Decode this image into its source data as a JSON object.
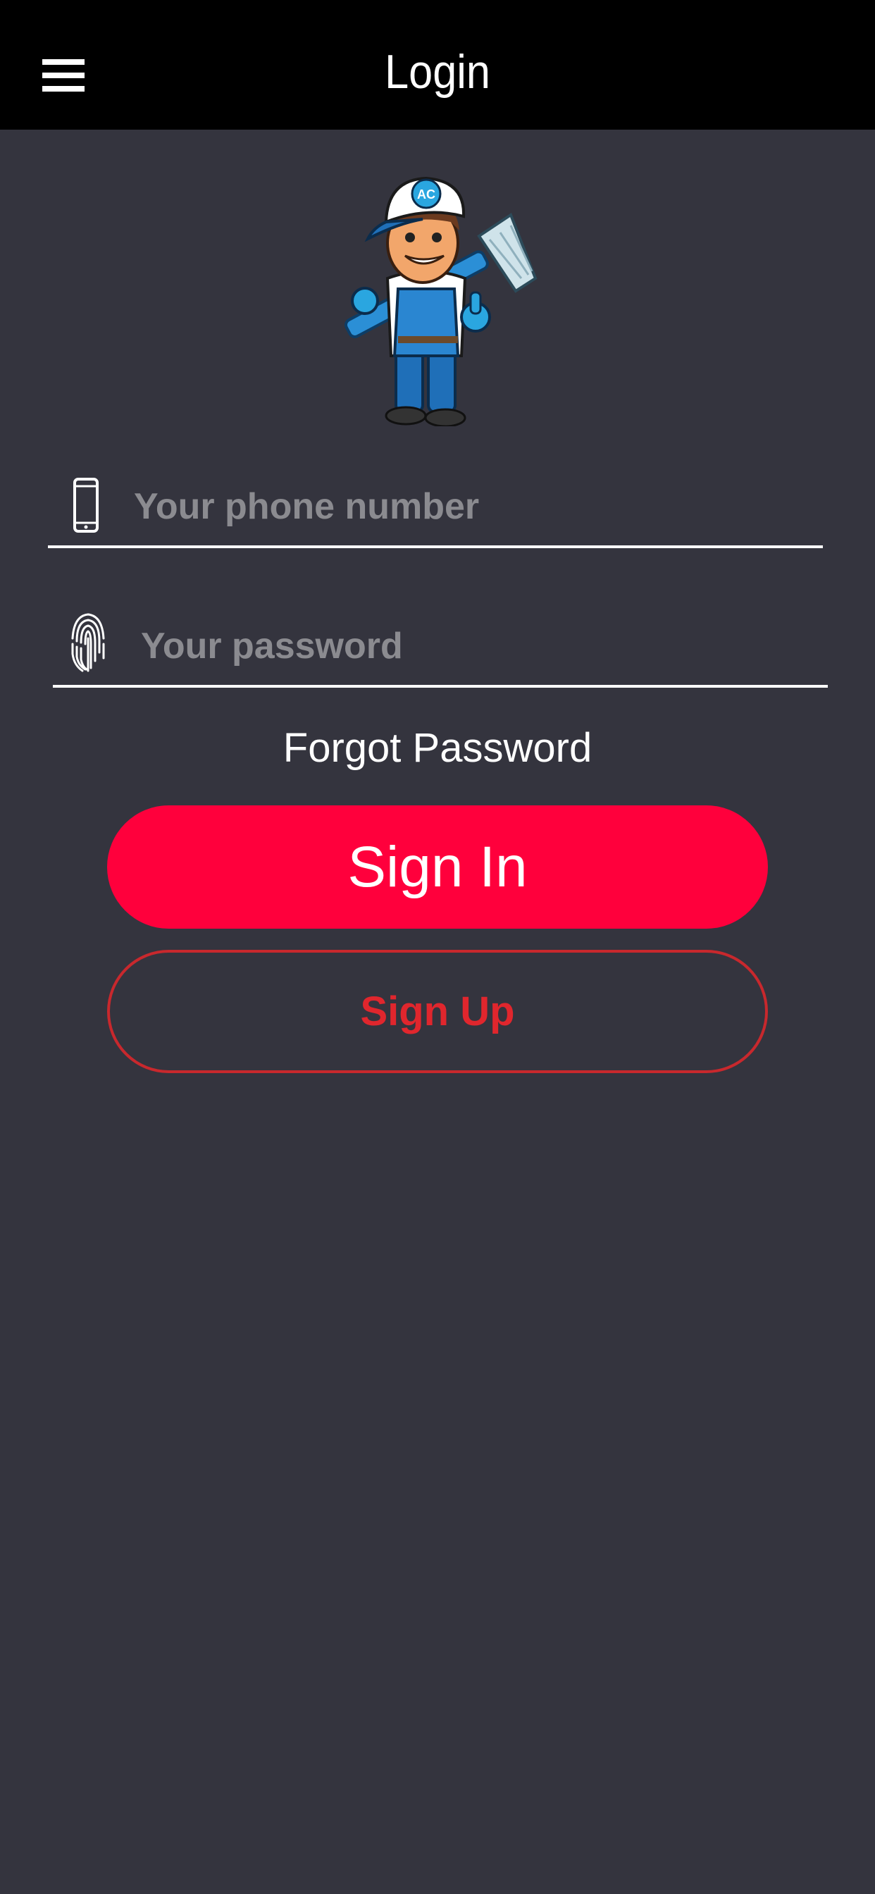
{
  "header": {
    "title": "Login",
    "menu_icon": "hamburger-menu-icon"
  },
  "logo": {
    "icon": "cleaner-mascot-logo",
    "cap_text": "AC"
  },
  "form": {
    "phone": {
      "placeholder": "Your phone number",
      "value": "",
      "icon": "smartphone-icon"
    },
    "password": {
      "placeholder": "Your password",
      "value": "",
      "icon": "fingerprint-icon"
    },
    "forgot_label": "Forgot Password"
  },
  "actions": {
    "signin_label": "Sign In",
    "signup_label": "Sign Up"
  },
  "colors": {
    "background": "#34343e",
    "header": "#000000",
    "primary": "#ff003c",
    "secondary": "#e0262d",
    "placeholder": "#8b8b90"
  }
}
